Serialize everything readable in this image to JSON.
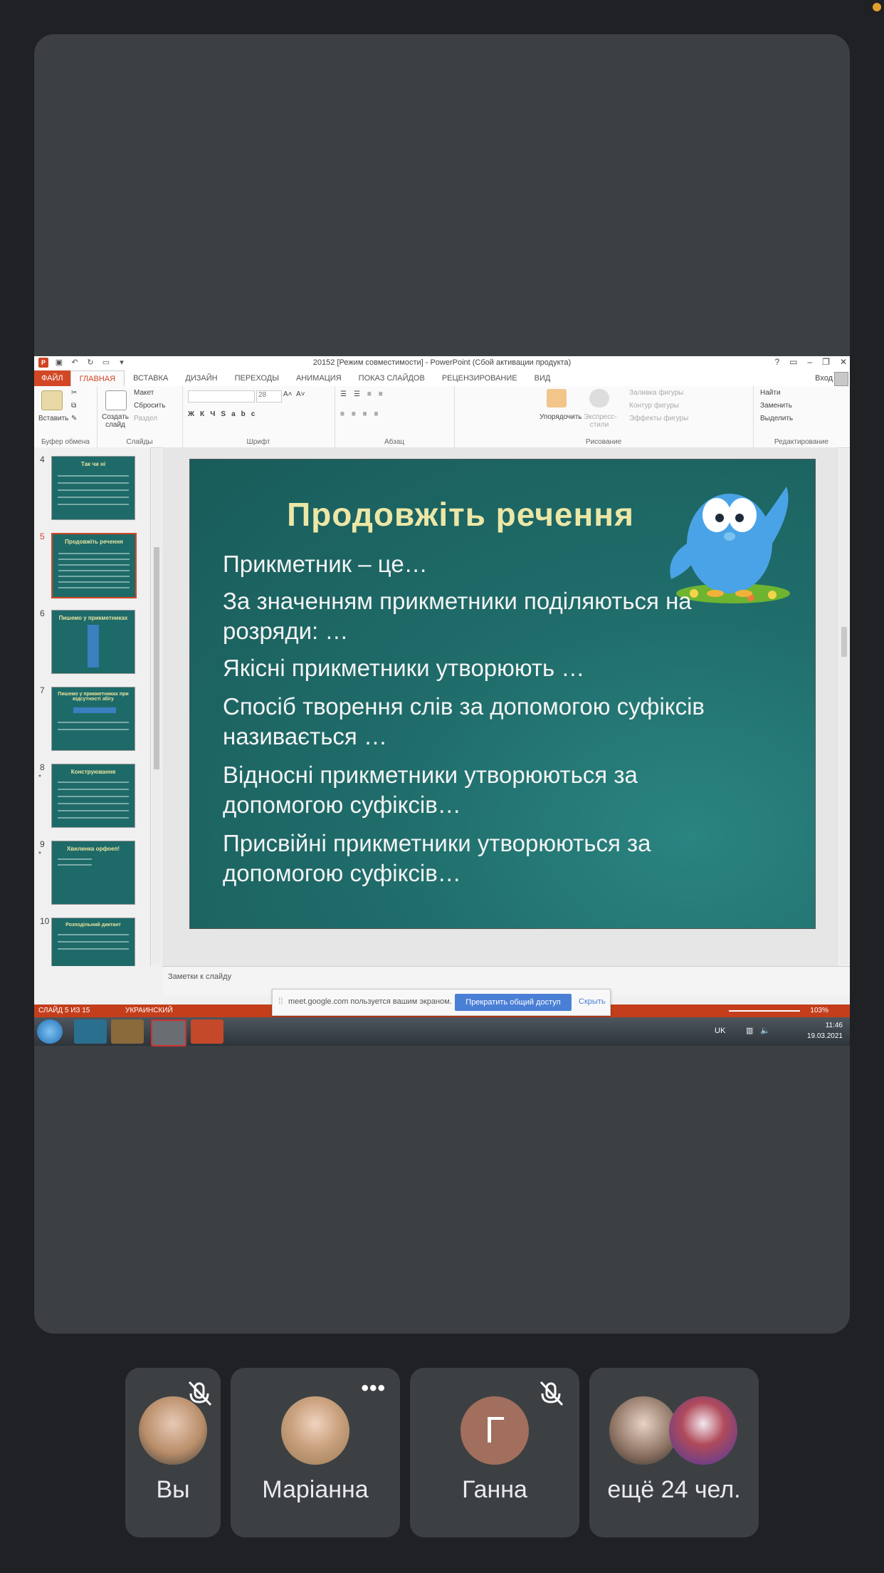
{
  "window": {
    "title": "20152 [Режим совместимости] - PowerPoint (Сбой активации продукта)",
    "signin": "Вход"
  },
  "tabs": [
    "ФАЙЛ",
    "ГЛАВНАЯ",
    "ВСТАВКА",
    "ДИЗАЙН",
    "ПЕРЕХОДЫ",
    "АНИМАЦИЯ",
    "ПОКАЗ СЛАЙДОВ",
    "РЕЦЕНЗИРОВАНИЕ",
    "ВИД"
  ],
  "ribbon": {
    "paste": "Вставить",
    "clipboard_group": "Буфер обмена",
    "new_slide": "Создать слайд",
    "layout": "Макет",
    "reset": "Сбросить",
    "section": "Раздел",
    "slides_group": "Слайды",
    "font_size": "28",
    "font_group": "Шрифт",
    "paragraph_group": "Абзац",
    "arrange": "Упорядочить",
    "quick_styles": "Экспресс-стили",
    "shape_fill": "Заливка фигуры",
    "shape_outline": "Контур фигуры",
    "shape_effects": "Эффекты фигуры",
    "drawing_group": "Рисование",
    "find": "Найти",
    "replace": "Заменить",
    "select": "Выделить",
    "editing_group": "Редактирование"
  },
  "thumbnails": [
    {
      "num": "4",
      "title": "Так чи ні",
      "star": ""
    },
    {
      "num": "5",
      "title": "Продовжіть речення",
      "star": ""
    },
    {
      "num": "6",
      "title": "Пишемо у прикметниках",
      "star": ""
    },
    {
      "num": "7",
      "title": "Пишемо у прикметниках при відсутності збігу",
      "star": ""
    },
    {
      "num": "8",
      "title": "Конструювання",
      "star": "*"
    },
    {
      "num": "9",
      "title": "Хвилинка орфоеп!",
      "star": "*"
    },
    {
      "num": "10",
      "title": "Розподільний диктант",
      "star": ""
    }
  ],
  "slide": {
    "title": "Продовжіть  речення",
    "items": [
      "Прикметник – це…",
      "За значенням прикметники поділяються на розряди: …",
      "Якісні прикметники утворюють …",
      "Спосіб творення слів за допомогою суфіксів називається …",
      "Відносні прикметники утворюються за допомогою суфіксів…",
      "Присвійні прикметники утворюються за допомогою суфіксів…"
    ]
  },
  "notes_placeholder": "Заметки к слайду",
  "status": {
    "slide_counter": "СЛАЙД 5 ИЗ 15",
    "language": "УКРАИНСКИЙ",
    "zoom": "103%"
  },
  "share_banner": {
    "text": "meet.google.com пользуется вашим экраном.",
    "stop": "Прекратить общий доступ",
    "hide": "Скрыть"
  },
  "taskbar": {
    "lang": "UK",
    "time": "11:46",
    "date": "19.03.2021"
  },
  "participants": [
    {
      "name": "Вы",
      "muted": true
    },
    {
      "name": "Маріанна",
      "muted": false
    },
    {
      "name": "Ганна",
      "initial": "Г",
      "muted": true
    },
    {
      "name": "ещё 24 чел."
    }
  ],
  "colors": {
    "powerpoint_accent": "#d24726",
    "slide_bg": "#1f6c6a",
    "slide_title": "#ece7a6",
    "meet_bg": "#202124",
    "tile_bg": "#3c4043"
  }
}
